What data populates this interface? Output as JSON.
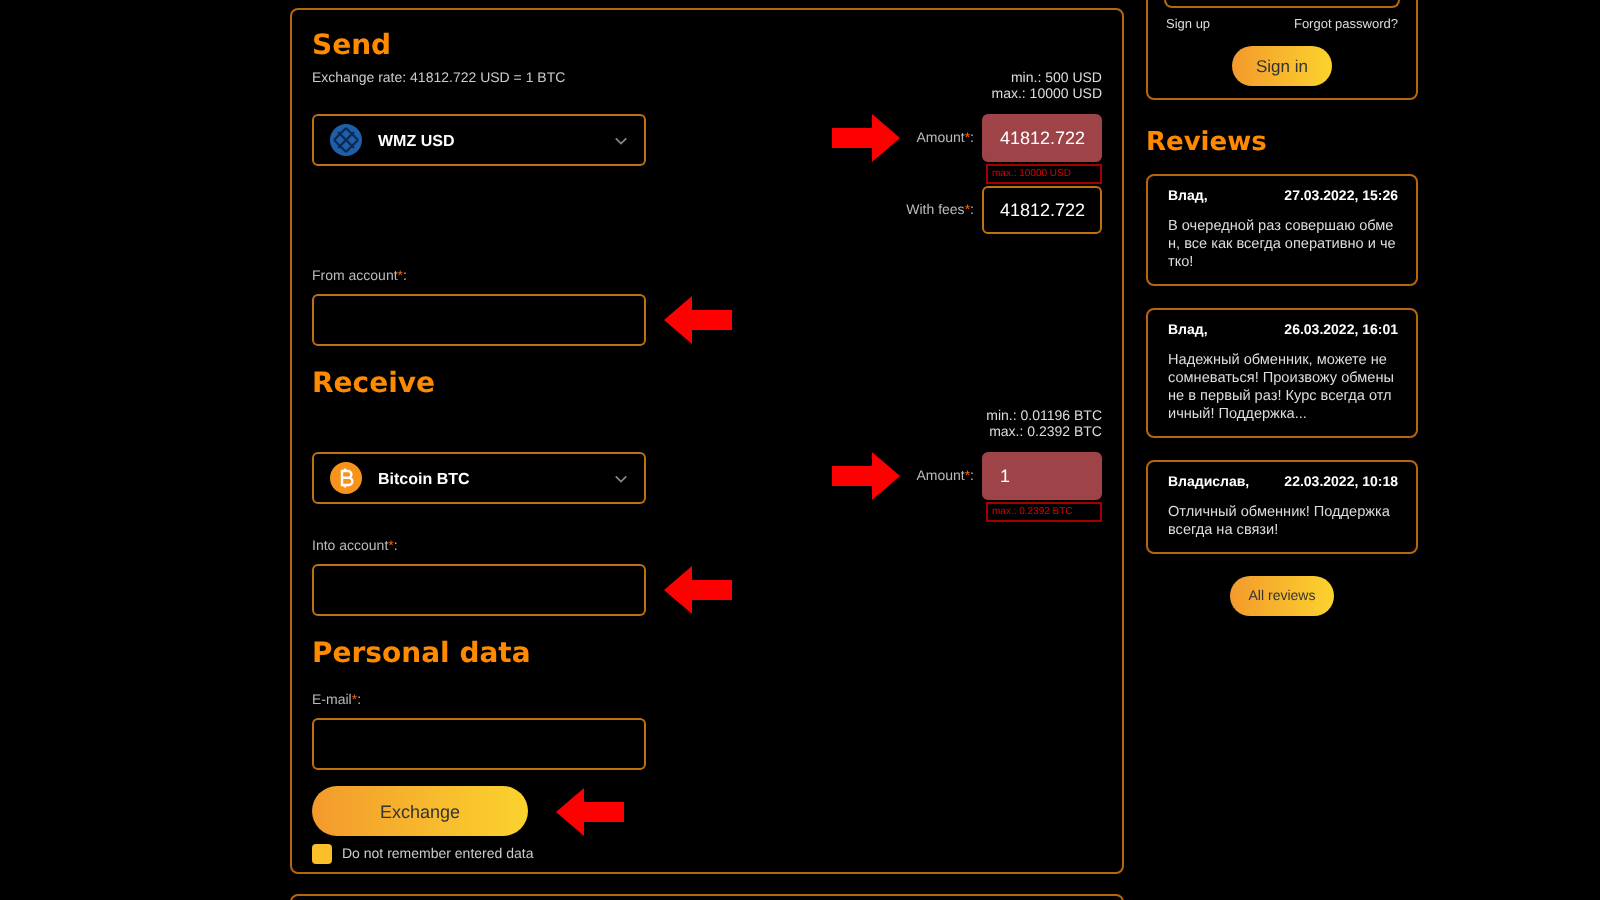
{
  "exchange": {
    "sections": [
      {
        "title": "Send",
        "rate": "Exchange rate: 41812.722 USD = 1 BTC",
        "currency": {
          "kind": "webmoney",
          "name": "WMZ USD"
        },
        "limits": [
          "min.: 500 USD",
          "max.: 10000 USD"
        ],
        "amount": {
          "label": "Amount",
          "mark": "*",
          "end": ":",
          "value": "41812.722",
          "invalid": true,
          "error": "max.: 10000 USD"
        },
        "fees": {
          "label": "With fees",
          "mark": "*",
          "end": ":",
          "value": "41812.722",
          "invalid": false
        },
        "account": {
          "label": "From account",
          "mark": "*",
          "end": ":"
        }
      },
      {
        "title": "Receive",
        "currency": {
          "kind": "bitcoin",
          "name": "Bitcoin BTC"
        },
        "limits": [
          "min.: 0.01196 BTC",
          "max.: 0.2392 BTC"
        ],
        "amount": {
          "label": "Amount",
          "mark": "*",
          "end": ":",
          "value": "1",
          "invalid": true,
          "error": "max.: 0.2392 BTC"
        },
        "account": {
          "label": "Into account",
          "mark": "*",
          "end": ":"
        }
      }
    ],
    "personal": {
      "title": "Personal data",
      "email": {
        "label": "E-mail",
        "mark": "*",
        "end": ":"
      }
    },
    "submit": "Exchange",
    "remember": {
      "label": "Do not remember entered data",
      "checked": false
    }
  },
  "login": {
    "sign_up": "Sign up",
    "forgot": "Forgot password?",
    "button": "Sign in"
  },
  "reviews": {
    "title": "Reviews",
    "items": [
      {
        "author": "Влад,",
        "date": "27.03.2022, 15:26",
        "text": "В очередной раз совершаю обмен, все как всегда оперативно и четко!"
      },
      {
        "author": "Влад,",
        "date": "26.03.2022, 16:01",
        "text": "Надежный обменник, можете не сомневаться! Произвожу обмены не в первый раз! Курс всегда отличный! Поддержка..."
      },
      {
        "author": "Владислав,",
        "date": "22.03.2022, 10:18",
        "text": "Отличный обменник! Поддержка всегда на связи!"
      }
    ],
    "all": "All reviews"
  }
}
